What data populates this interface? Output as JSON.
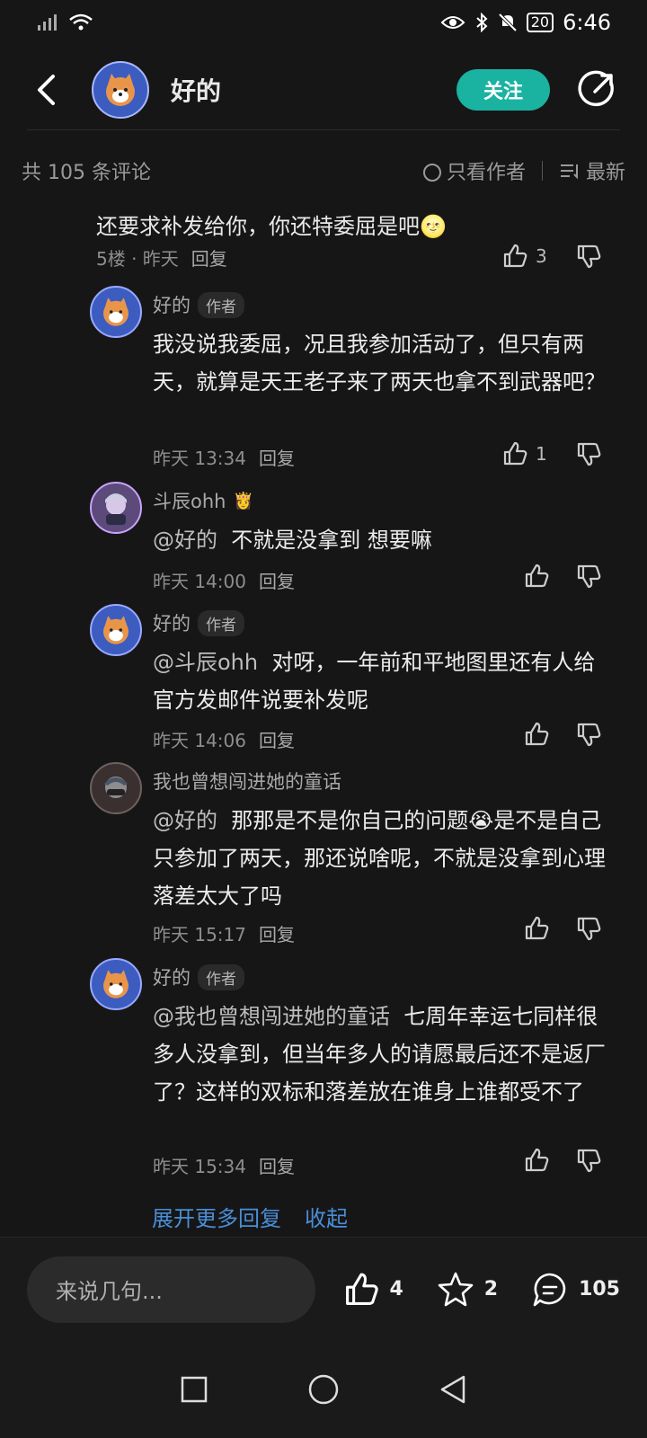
{
  "status": {
    "time": "6:46",
    "battery": "20"
  },
  "header": {
    "title": "好的",
    "follow": "关注"
  },
  "summary": {
    "count": "共 105 条评论",
    "only_author": "只看作者",
    "sort": "最新"
  },
  "parent": {
    "text": "还要求补发给你，你还特委屈是吧🌝",
    "floor_time": "5楼 · 昨天",
    "reply": "回复",
    "likes": "3"
  },
  "replies": [
    {
      "user": "好的",
      "tag": "作者",
      "mention": "",
      "text": "我没说我委屈，况且我参加活动了，但只有两天，就算是天王老子来了两天也拿不到武器吧？",
      "time": "昨天 13:34",
      "reply": "回复",
      "likes": "1"
    },
    {
      "user": "斗辰ohh",
      "tag": "",
      "badge": "👸",
      "mention": "@好的",
      "text": "不就是没拿到 想要嘛",
      "time": "昨天 14:00",
      "reply": "回复",
      "likes": ""
    },
    {
      "user": "好的",
      "tag": "作者",
      "mention": "@斗辰ohh",
      "text": "对呀，一年前和平地图里还有人给官方发邮件说要补发呢",
      "time": "昨天 14:06",
      "reply": "回复",
      "likes": ""
    },
    {
      "user": "我也曾想闯进她的童话",
      "tag": "",
      "mention": "@好的",
      "text": "那那是不是你自己的问题😭是不是自己只参加了两天，那还说啥呢，不就是没拿到心理落差太大了吗",
      "time": "昨天 15:17",
      "reply": "回复",
      "likes": ""
    },
    {
      "user": "好的",
      "tag": "作者",
      "mention": "@我也曾想闯进她的童话",
      "text": "七周年幸运七同样很多人没拿到，但当年多人的请愿最后还不是返厂了？这样的双标和落差放在谁身上谁都受不了",
      "time": "昨天 15:34",
      "reply": "回复",
      "likes": ""
    }
  ],
  "expand": {
    "more": "展开更多回复",
    "collapse": "收起"
  },
  "bottom": {
    "placeholder": "来说几句...",
    "likes": "4",
    "favorites": "2",
    "comments": "105"
  }
}
